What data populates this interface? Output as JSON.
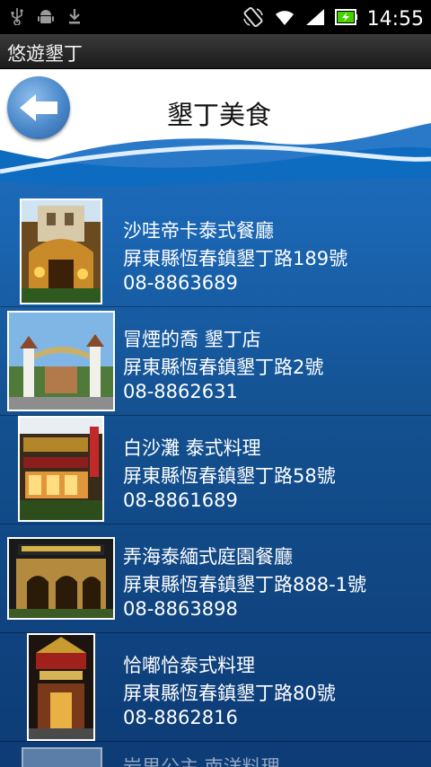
{
  "status_bar": {
    "time": "14:55",
    "icons": [
      "usb-icon",
      "android-debug-icon",
      "download-icon",
      "rotate-icon",
      "wifi-icon",
      "signal-icon",
      "battery-charging-icon"
    ]
  },
  "app": {
    "title": "悠遊墾丁"
  },
  "header": {
    "title": "墾丁美食",
    "back_icon": "back-arrow-icon"
  },
  "restaurants": [
    {
      "name": "沙哇帝卡泰式餐廳",
      "address": "屏東縣恆春鎮墾丁路189號",
      "phone": "08-8863689"
    },
    {
      "name": "冒煙的喬 墾丁店",
      "address": "屏東縣恆春鎮墾丁路2號",
      "phone": "08-8862631"
    },
    {
      "name": "白沙灘 泰式料理",
      "address": "屏東縣恆春鎮墾丁路58號",
      "phone": "08-8861689"
    },
    {
      "name": "弄海泰緬式庭園餐廳",
      "address": "屏東縣恆春鎮墾丁路888-1號",
      "phone": "08-8863898"
    },
    {
      "name": "恰嘟恰泰式料理",
      "address": "屏東縣恆春鎮墾丁路80號",
      "phone": "08-8862816"
    },
    {
      "name": "岩里公主 南洋料理"
    }
  ],
  "colors": {
    "list_top": "#1c69b8",
    "list_bottom": "#0d3b75",
    "title_bar": "#2a2a2a"
  }
}
